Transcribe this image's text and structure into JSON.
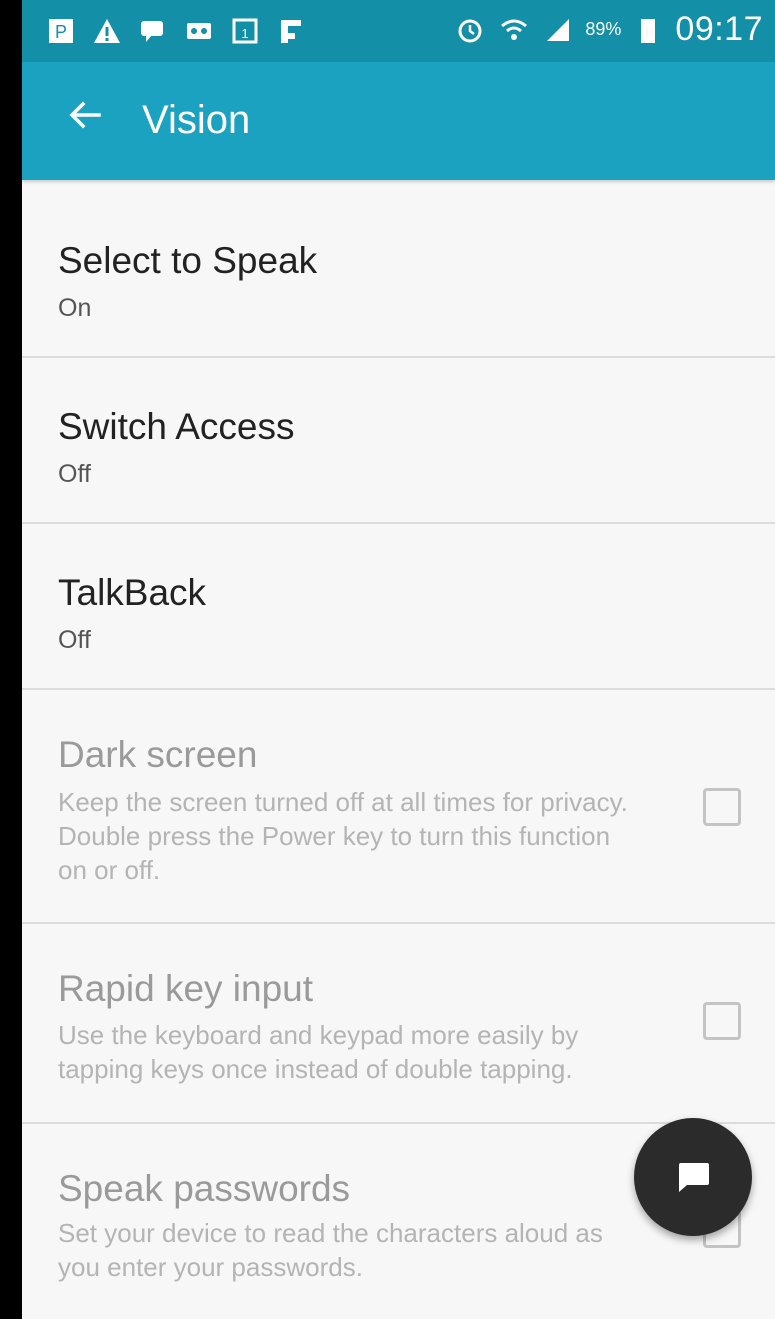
{
  "status_bar": {
    "left_icons": [
      "notification-p-icon",
      "warning-icon",
      "chat-bubble-icon",
      "voicemail-icon",
      "calendar-icon",
      "flipboard-icon"
    ],
    "right_icons": [
      "alarm-icon",
      "wifi-icon",
      "signal-icon",
      "battery-icon"
    ],
    "battery": "89%",
    "time": "09:17"
  },
  "app_bar": {
    "title": "Vision",
    "background": "#1aa2c0"
  },
  "items": [
    {
      "title": "Select to Speak",
      "status": "On"
    },
    {
      "title": "Switch Access",
      "status": "Off"
    },
    {
      "title": "TalkBack",
      "status": "Off"
    },
    {
      "title": "Dark screen",
      "description": "Keep the screen turned off at all times for privacy. Double press the Power key to turn this function on or off.",
      "checked": false
    },
    {
      "title": "Rapid key input",
      "description": "Use the keyboard and keypad more easily by tapping keys once instead of double tapping.",
      "checked": false
    },
    {
      "title": "Speak passwords",
      "description": "Set your device to read the characters aloud as you enter your passwords.",
      "checked": false
    }
  ],
  "fab": {
    "icon": "chat-icon"
  }
}
